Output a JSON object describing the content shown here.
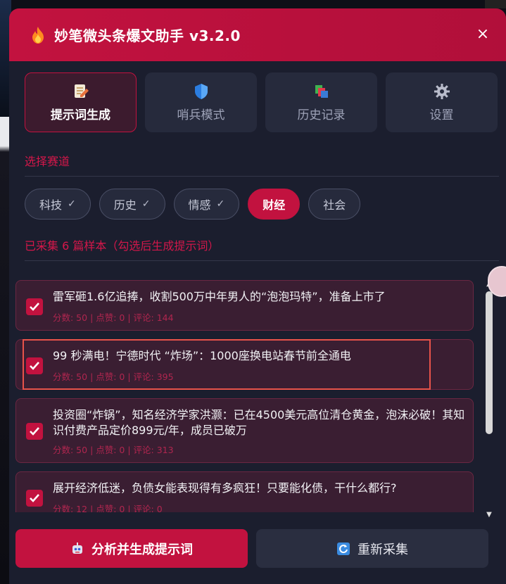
{
  "app": {
    "title": "妙笔微头条爆文助手 v3.2.0",
    "close_symbol": "×",
    "accent": "#c2123f"
  },
  "tabs": [
    {
      "label": "提示词生成",
      "icon": "edit-document-icon",
      "active": true
    },
    {
      "label": "哨兵模式",
      "icon": "shield-icon",
      "active": false
    },
    {
      "label": "历史记录",
      "icon": "stacked-books-icon",
      "active": false
    },
    {
      "label": "设置",
      "icon": "gear-icon",
      "active": false
    }
  ],
  "track_section": {
    "label": "选择赛道",
    "chips": [
      {
        "label": "科技",
        "check": "✓",
        "active": false
      },
      {
        "label": "历史",
        "check": "✓",
        "active": false
      },
      {
        "label": "情感",
        "check": "✓",
        "active": false
      },
      {
        "label": "财经",
        "check": "",
        "active": true
      },
      {
        "label": "社会",
        "check": "",
        "active": false
      }
    ]
  },
  "samples": {
    "label": "已采集 6 篇样本（勾选后生成提示词）",
    "items": [
      {
        "title": "雷军砸1.6亿追捧，收割500万中年男人的“泡泡玛特”，准备上市了",
        "meta": "分数: 50 | 点赞: 0 | 评论: 144",
        "checked": true
      },
      {
        "title": "99 秒满电！宁德时代 “炸场”：1000座换电站春节前全通电",
        "meta": "分数: 50 | 点赞: 0 | 评论: 395",
        "checked": true
      },
      {
        "title": "投资圈“炸锅”，知名经济学家洪灏：已在4500美元高位清仓黄金，泡沫必破！其知识付费产品定价899元/年，成员已破万",
        "meta": "分数: 50 | 点赞: 0 | 评论: 313",
        "checked": true
      },
      {
        "title": "展开经济低迷，负债女能表现得有多疯狂！只要能化债，干什么都行?",
        "meta": "分数: 12 | 点赞: 0 | 评论: 0",
        "checked": true
      }
    ]
  },
  "footer": {
    "analyze_label": "分析并生成提示词",
    "analyze_icon": "robot-icon",
    "recollect_label": "重新采集",
    "recollect_icon": "refresh-icon"
  }
}
